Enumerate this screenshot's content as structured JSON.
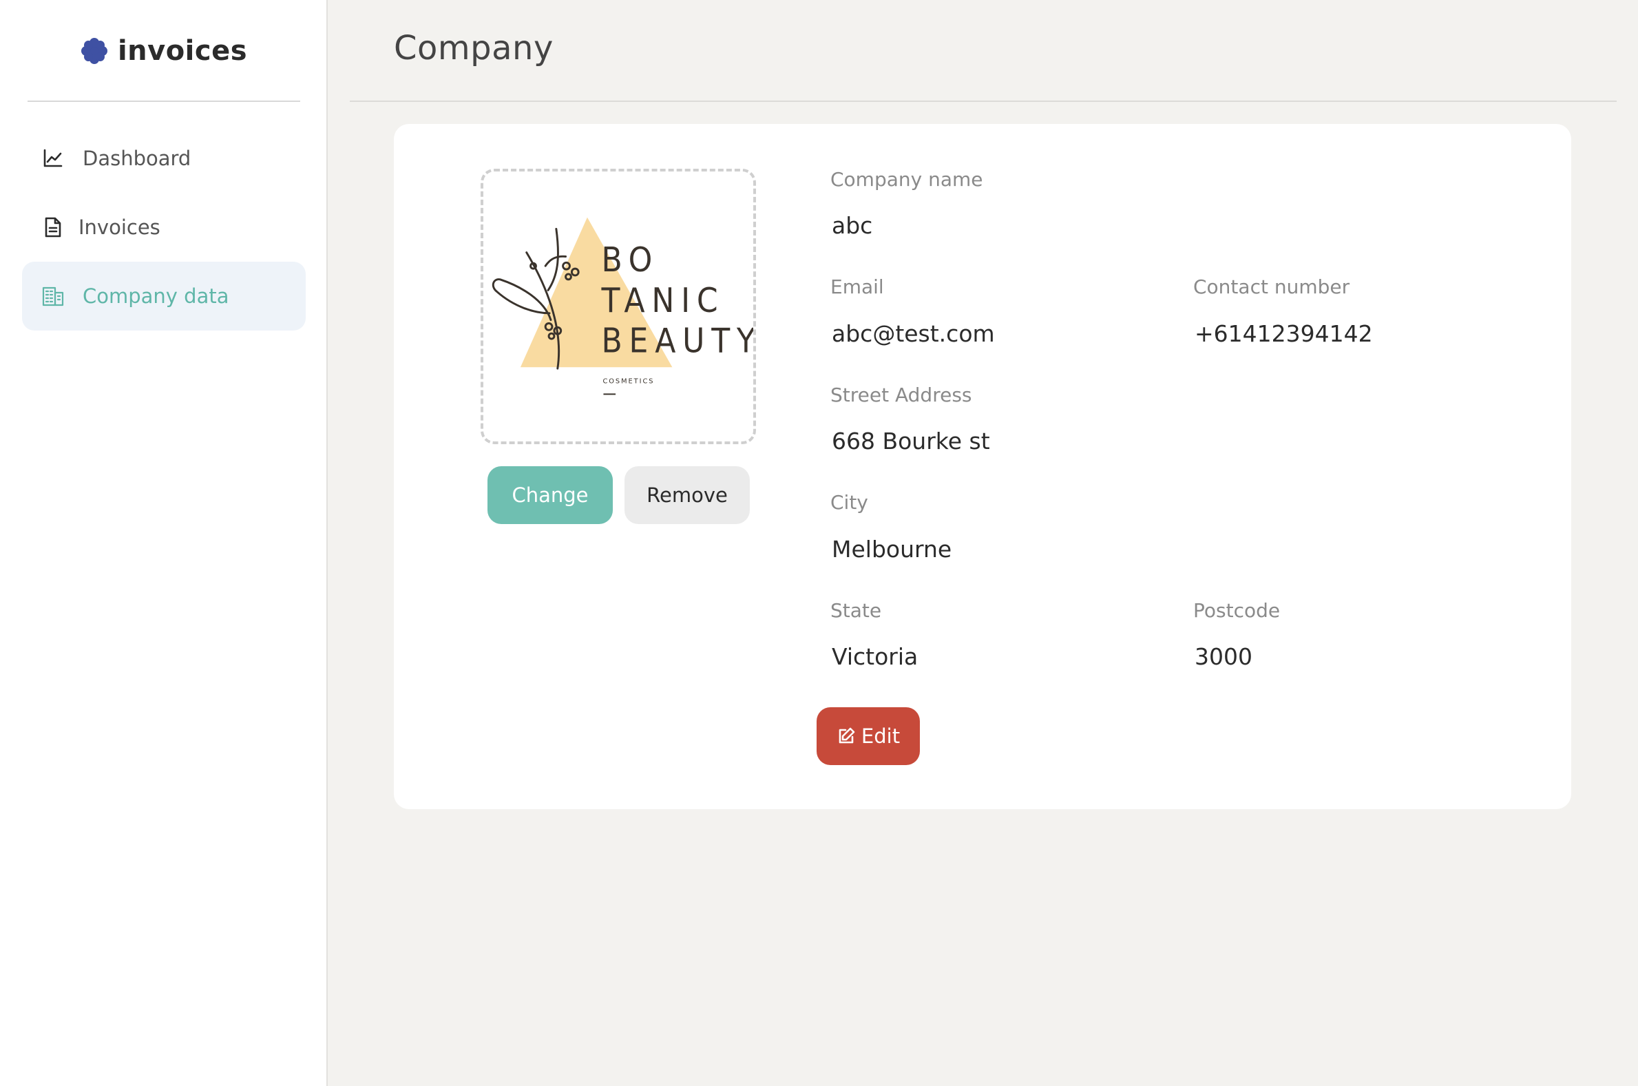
{
  "app": {
    "name": "invoices"
  },
  "sidebar": {
    "items": [
      {
        "label": "Dashboard",
        "icon": "chart-line-icon",
        "active": false
      },
      {
        "label": "Invoices",
        "icon": "file-document-icon",
        "active": false
      },
      {
        "label": "Company data",
        "icon": "building-icon",
        "active": true
      }
    ]
  },
  "page": {
    "title": "Company"
  },
  "logo": {
    "text_line1": "BO",
    "text_line2": "TANIC",
    "text_line3": "BEAUTY",
    "tagline": "COSMETICS"
  },
  "buttons": {
    "change": "Change",
    "remove": "Remove",
    "edit": "Edit"
  },
  "fields": {
    "company_name": {
      "label": "Company name",
      "value": "abc"
    },
    "email": {
      "label": "Email",
      "value": "abc@test.com"
    },
    "contact_number": {
      "label": "Contact number",
      "value": "+61412394142"
    },
    "street_address": {
      "label": "Street Address",
      "value": "668 Bourke st"
    },
    "city": {
      "label": "City",
      "value": "Melbourne"
    },
    "state": {
      "label": "State",
      "value": "Victoria"
    },
    "postcode": {
      "label": "Postcode",
      "value": "3000"
    }
  },
  "colors": {
    "accent": "#6fbfb1",
    "active_nav_bg": "#eef3f9",
    "edit_button": "#c74a3a",
    "brand_logo": "#3f51a3",
    "logo_triangle": "#f9dba1"
  }
}
